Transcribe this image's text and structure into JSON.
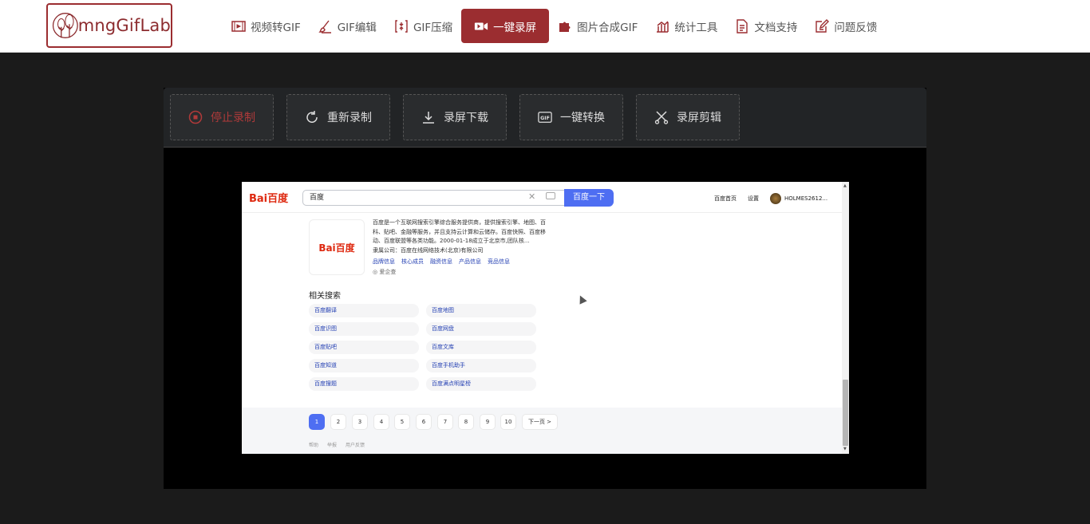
{
  "header": {
    "logo_text": "mngGifLab",
    "nav": [
      {
        "label": "视频转GIF",
        "icon": "film-icon"
      },
      {
        "label": "GIF编辑",
        "icon": "brush-icon"
      },
      {
        "label": "GIF压缩",
        "icon": "compress-icon"
      },
      {
        "label": "一键录屏",
        "icon": "video-camera-icon"
      },
      {
        "label": "图片合成GIF",
        "icon": "puzzle-icon"
      },
      {
        "label": "统计工具",
        "icon": "chart-icon"
      },
      {
        "label": "文档支持",
        "icon": "document-icon"
      },
      {
        "label": "问题反馈",
        "icon": "edit-icon"
      }
    ],
    "active_index": 3
  },
  "toolbar": {
    "buttons": [
      {
        "label": "停止录制",
        "icon": "stop-circle-icon"
      },
      {
        "label": "重新录制",
        "icon": "refresh-icon"
      },
      {
        "label": "录屏下载",
        "icon": "download-icon"
      },
      {
        "label": "一键转换",
        "icon": "gif-icon"
      },
      {
        "label": "录屏剪辑",
        "icon": "scissors-icon"
      }
    ]
  },
  "recording": {
    "baidu_logo": "Bai百度",
    "search_value": "百度",
    "search_button": "百度一下",
    "top_links": [
      "百度首页",
      "设置"
    ],
    "username": "HOLMES2612...",
    "card_logo": "Bai百度",
    "desc_lines": [
      "百度是一个互联网搜索引擎综合服务提供商，提供搜索引擎、地图、百",
      "科、贴吧、金融等服务，并且支持云计算和云储存。百度快照、百度移",
      "动、百度联盟等各类功能。2000-01-18成立于北京市,团队核...",
      "隶属公司：百度在线网络技术(北京)有限公司"
    ],
    "card_links": [
      "品牌信息",
      "核心成员",
      "融资信息",
      "产品信息",
      "竞品信息"
    ],
    "aiqi": "爱企查",
    "related_title": "相关搜索",
    "related": [
      "百度翻译",
      "百度地图",
      "百度识图",
      "百度网盘",
      "百度贴吧",
      "百度文库",
      "百度知道",
      "百度手机助手",
      "百度搜题",
      "百度满点明星榜"
    ],
    "pages": [
      "1",
      "2",
      "3",
      "4",
      "5",
      "6",
      "7",
      "8",
      "9",
      "10"
    ],
    "next_page": "下一页 >",
    "footer_links": [
      "帮助",
      "举报",
      "用户反馈"
    ]
  },
  "colors": {
    "brand": "#9b2d30",
    "baidu_blue": "#4e6ef2",
    "baidu_red": "#de2910"
  }
}
